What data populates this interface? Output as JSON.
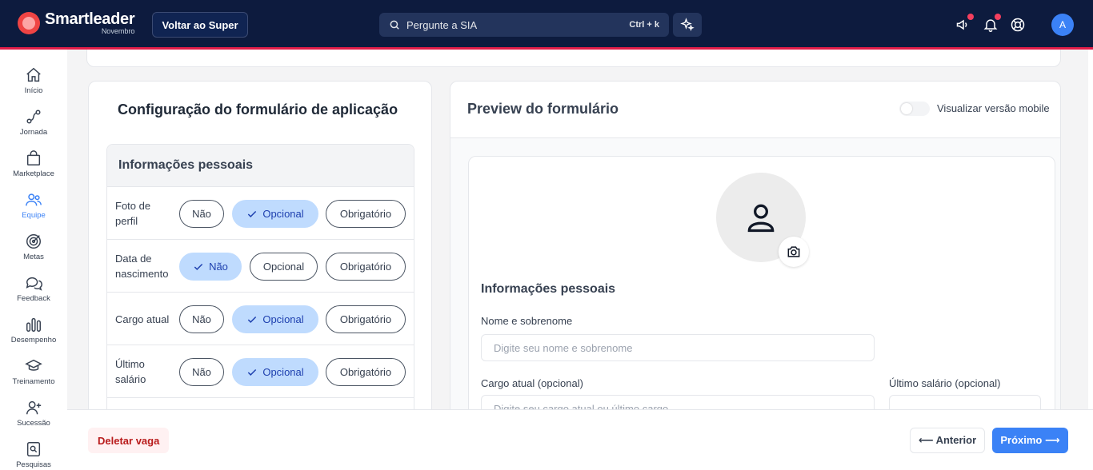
{
  "header": {
    "brand_name": "Smartleader",
    "brand_sub": "Novembro",
    "super_button": "Voltar ao Super",
    "search_placeholder": "Pergunte a SIA",
    "search_shortcut": "Ctrl + k",
    "avatar_initial": "A",
    "icons": [
      "megaphone-icon",
      "bell-icon",
      "help-lifebuoy-icon",
      "sparkle-icon"
    ]
  },
  "sidebar": {
    "items": [
      {
        "label": "Início",
        "icon": "home-icon"
      },
      {
        "label": "Jornada",
        "icon": "route-icon"
      },
      {
        "label": "Marketplace",
        "icon": "shopping-bag-icon"
      },
      {
        "label": "Equipe",
        "icon": "team-icon",
        "active": true
      },
      {
        "label": "Metas",
        "icon": "target-icon"
      },
      {
        "label": "Feedback",
        "icon": "chat-icon"
      },
      {
        "label": "Desempenho",
        "icon": "bar-chart-icon"
      },
      {
        "label": "Treinamento",
        "icon": "graduation-cap-icon"
      },
      {
        "label": "Sucessão",
        "icon": "user-plus-icon"
      },
      {
        "label": "Pesquisas",
        "icon": "search-document-icon"
      }
    ]
  },
  "config": {
    "title": "Configuração do formulário de aplicação",
    "section_title": "Informações pessoais",
    "option_labels": {
      "nao": "Não",
      "opcional": "Opcional",
      "obrigatorio": "Obrigatório"
    },
    "fields": [
      {
        "label": "Foto de perfil",
        "selected": "Opcional"
      },
      {
        "label": "Data de nascimento",
        "selected": "Não"
      },
      {
        "label": "Cargo atual",
        "selected": "Opcional"
      },
      {
        "label": "Último salário",
        "selected": "Opcional"
      }
    ]
  },
  "preview": {
    "title": "Preview do formulário",
    "mobile_toggle_label": "Visualizar versão mobile",
    "mobile_toggle_on": false,
    "section_title": "Informações pessoais",
    "name_label": "Nome e sobrenome",
    "name_placeholder": "Digite seu nome e sobrenome",
    "job_label": "Cargo atual (opcional)",
    "job_placeholder": "Digite seu cargo atual ou último cargo",
    "salary_label": "Último salário (opcional)"
  },
  "footer": {
    "delete_label": "Deletar vaga",
    "prev_label": "⟵ Anterior",
    "next_label": "Próximo ⟶"
  },
  "colors": {
    "navy": "#0d1b3e",
    "accent_red": "#e11d48",
    "primary_blue": "#3b82f6",
    "selected_bg": "#bfdbfe"
  }
}
